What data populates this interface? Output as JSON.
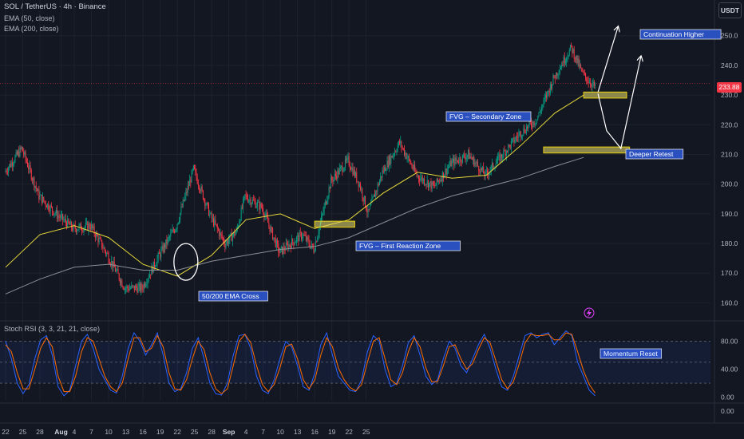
{
  "header": {
    "title": "SOL / TetherUS · 4h · Binance",
    "ema50_label": "EMA (50, close)",
    "ema200_label": "EMA (200, close)",
    "currency": "USDT",
    "last_price": "233.88"
  },
  "colors": {
    "background": "#131722",
    "grid": "#1e222d",
    "bull": "#089981",
    "bear": "#f23645",
    "ema50": "#e6d83a",
    "ema200": "#8a8d93",
    "zone_fill": "#efe16a",
    "zone_border": "#d8c21a",
    "annotation_bg": "#2a4fbf",
    "stoch_k": "#2962ff",
    "stoch_d": "#ff6d00"
  },
  "annotations": {
    "ema_cross": "50/200 EMA Cross",
    "fvg_first": "FVG – First Reaction Zone",
    "fvg_secondary": "FVG – Secondary Zone",
    "continuation": "Continuation Higher",
    "deeper_retest": "Deeper Retest",
    "momentum_reset": "Momentum Reset"
  },
  "stoch_label": "Stoch RSI (3, 3, 21, 21, close)",
  "chart_data": [
    {
      "type": "candlestick",
      "title": "SOL / TetherUS · 4h · Binance",
      "y_ticks": [
        160,
        170,
        180,
        190,
        200,
        210,
        220,
        230,
        240,
        250
      ],
      "ylim": [
        155,
        258
      ],
      "x_ticks": [
        "22",
        "25",
        "28",
        "Aug",
        "4",
        "7",
        "10",
        "13",
        "16",
        "19",
        "22",
        "25",
        "28",
        "Sep",
        "4",
        "7",
        "10",
        "13",
        "16",
        "19",
        "22",
        "25"
      ],
      "price_path": [
        [
          0,
          204
        ],
        [
          3,
          212
        ],
        [
          6,
          196
        ],
        [
          9,
          190
        ],
        [
          12,
          185
        ],
        [
          15,
          186
        ],
        [
          18,
          176
        ],
        [
          21,
          165
        ],
        [
          24,
          165
        ],
        [
          27,
          176
        ],
        [
          30,
          186
        ],
        [
          33,
          205
        ],
        [
          36,
          189
        ],
        [
          38.5,
          180
        ],
        [
          40.5,
          184
        ],
        [
          42,
          196
        ],
        [
          45,
          192
        ],
        [
          48,
          177
        ],
        [
          50,
          180
        ],
        [
          52,
          183
        ],
        [
          54,
          178
        ],
        [
          57,
          201
        ],
        [
          60,
          208
        ],
        [
          62,
          200
        ],
        [
          63.5,
          190
        ],
        [
          66,
          204
        ],
        [
          69,
          214
        ],
        [
          72,
          203
        ],
        [
          75,
          199
        ],
        [
          78,
          207
        ],
        [
          81,
          210
        ],
        [
          84,
          203
        ],
        [
          87,
          210
        ],
        [
          90,
          217
        ],
        [
          93,
          222
        ],
        [
          96,
          236
        ],
        [
          99,
          246
        ],
        [
          101,
          237
        ],
        [
          103,
          233
        ]
      ],
      "series": [
        {
          "name": "EMA (50, close)",
          "points": [
            [
              0,
              172
            ],
            [
              6,
              183
            ],
            [
              12,
              186
            ],
            [
              18,
              182
            ],
            [
              24,
              173
            ],
            [
              30,
              169
            ],
            [
              36,
              176
            ],
            [
              42,
              188
            ],
            [
              48,
              190
            ],
            [
              54,
              185
            ],
            [
              60,
              188
            ],
            [
              66,
              197
            ],
            [
              72,
              204
            ],
            [
              78,
              202
            ],
            [
              84,
              203
            ],
            [
              90,
              213
            ],
            [
              96,
              224
            ],
            [
              101,
              230
            ]
          ]
        },
        {
          "name": "EMA (200, close)",
          "points": [
            [
              0,
              163
            ],
            [
              6,
              168
            ],
            [
              12,
              172
            ],
            [
              18,
              173
            ],
            [
              24,
              171
            ],
            [
              30,
              171
            ],
            [
              36,
              174
            ],
            [
              42,
              176
            ],
            [
              48,
              178
            ],
            [
              54,
              179
            ],
            [
              60,
              182
            ],
            [
              66,
              187
            ],
            [
              72,
              192
            ],
            [
              78,
              196
            ],
            [
              84,
              199
            ],
            [
              90,
              202
            ],
            [
              96,
              206
            ],
            [
              101,
              209
            ]
          ]
        }
      ],
      "zones": [
        {
          "name": "FVG – First Reaction Zone",
          "x": [
            54,
            61
          ],
          "y": [
            185.5,
            187.5
          ]
        },
        {
          "name": "FVG – Secondary Zone",
          "x": [
            101,
            108.5
          ],
          "y": [
            229,
            231
          ]
        },
        {
          "name": "Deeper Retest",
          "x": [
            94,
            109
          ],
          "y": [
            210.5,
            212.5
          ]
        }
      ],
      "projections": [
        [
          [
            103.5,
            231
          ],
          [
            107,
            253
          ]
        ],
        [
          [
            103.5,
            230.5
          ],
          [
            105,
            218
          ],
          [
            107.5,
            212
          ],
          [
            111,
            243
          ]
        ]
      ],
      "last_price": 233.88
    },
    {
      "type": "line",
      "title": "Stoch RSI (3, 3, 21, 21, close)",
      "y_ticks": [
        0,
        40,
        80
      ],
      "ylim": [
        -5,
        100
      ],
      "bands": [
        20,
        80
      ],
      "series": [
        {
          "name": "K",
          "values": [
            80,
            55,
            20,
            5,
            18,
            55,
            82,
            88,
            60,
            15,
            2,
            10,
            45,
            80,
            90,
            70,
            40,
            25,
            10,
            6,
            30,
            70,
            92,
            80,
            60,
            75,
            92,
            60,
            20,
            8,
            12,
            35,
            70,
            85,
            55,
            20,
            5,
            3,
            20,
            60,
            88,
            90,
            70,
            30,
            10,
            5,
            25,
            55,
            80,
            72,
            45,
            15,
            10,
            35,
            75,
            92,
            60,
            30,
            20,
            10,
            8,
            25,
            65,
            88,
            80,
            40,
            15,
            20,
            45,
            78,
            88,
            60,
            30,
            18,
            25,
            55,
            80,
            70,
            45,
            35,
            55,
            75,
            90,
            70,
            40,
            15,
            10,
            30,
            60,
            88,
            92,
            85,
            90,
            92,
            75,
            85,
            95,
            88,
            50,
            30,
            10,
            2
          ]
        },
        {
          "name": "D",
          "values": [
            75,
            65,
            35,
            12,
            12,
            40,
            70,
            85,
            72,
            30,
            8,
            8,
            30,
            65,
            85,
            80,
            55,
            30,
            15,
            8,
            20,
            55,
            85,
            85,
            65,
            70,
            88,
            72,
            35,
            12,
            10,
            25,
            55,
            80,
            68,
            35,
            12,
            5,
            12,
            45,
            80,
            90,
            78,
            45,
            18,
            8,
            18,
            42,
            72,
            76,
            55,
            25,
            12,
            25,
            60,
            85,
            72,
            42,
            25,
            14,
            9,
            18,
            50,
            80,
            85,
            55,
            25,
            18,
            35,
            65,
            85,
            72,
            42,
            22,
            22,
            45,
            72,
            75,
            55,
            40,
            48,
            68,
            85,
            78,
            52,
            25,
            12,
            22,
            48,
            78,
            90,
            88,
            88,
            90,
            82,
            82,
            92,
            90,
            65,
            38,
            18,
            6
          ]
        }
      ]
    }
  ]
}
